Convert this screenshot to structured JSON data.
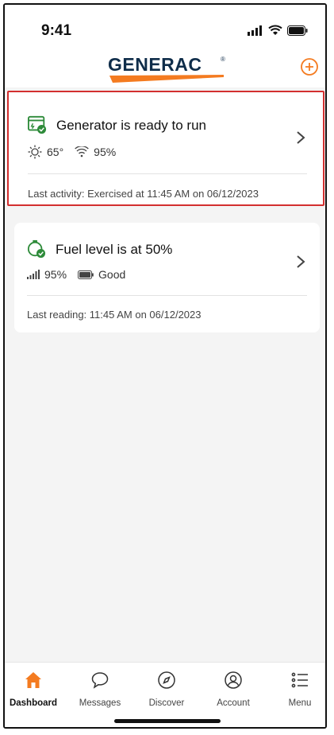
{
  "status_bar": {
    "time": "9:41"
  },
  "header": {
    "logo_text": "GENERAC",
    "logo_mark": "®"
  },
  "cards": [
    {
      "title": "Generator is ready to run",
      "temp": "65°",
      "signal": "95%",
      "footer": "Last activity: Exercised at 11:45 AM on 06/12/2023"
    },
    {
      "title": "Fuel level is at 50%",
      "signal": "95%",
      "battery": "Good",
      "footer": "Last reading: 11:45 AM on 06/12/2023"
    }
  ],
  "tabs": [
    {
      "label": "Dashboard",
      "icon": "home-icon",
      "active": true
    },
    {
      "label": "Messages",
      "icon": "chat-bubble-icon"
    },
    {
      "label": "Discover",
      "icon": "compass-icon"
    },
    {
      "label": "Account",
      "icon": "account-icon"
    },
    {
      "label": "Menu",
      "icon": "menu-list-icon"
    }
  ],
  "colors": {
    "accent": "#f47b20",
    "success": "#2e8b3a",
    "highlight": "#d32f2f",
    "brand": "#0f2d4a"
  }
}
